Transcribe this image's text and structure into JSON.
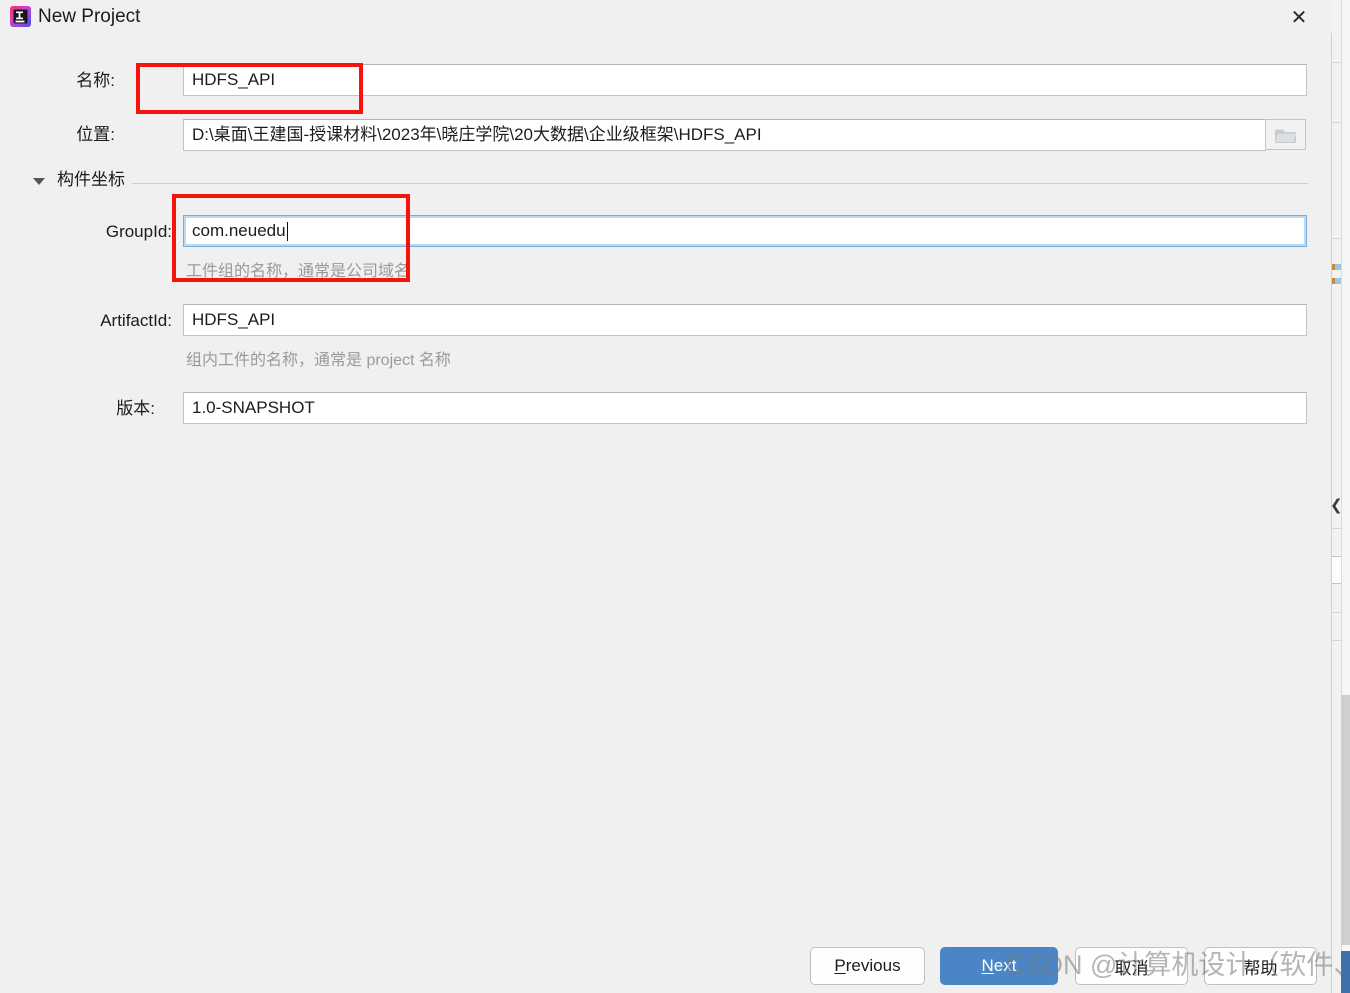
{
  "window": {
    "title": "New Project",
    "app_icon": "intellij-idea-icon",
    "close_icon": "close-icon"
  },
  "form": {
    "name": {
      "label": "名称:",
      "value": "HDFS_API"
    },
    "location": {
      "label": "位置:",
      "value": "D:\\桌面\\王建国-授课材料\\2023年\\晓庄学院\\20大数据\\企业级框架\\HDFS_API",
      "browse_icon": "folder-icon"
    },
    "section": {
      "title": "构件坐标",
      "expand_icon": "triangle-down-icon"
    },
    "group_id": {
      "label": "GroupId:",
      "value": "com.neuedu",
      "hint": "工件组的名称，通常是公司域名"
    },
    "artifact_id": {
      "label": "ArtifactId:",
      "value": "HDFS_API",
      "hint": "组内工件的名称，通常是 project 名称"
    },
    "version": {
      "label": "版本:",
      "value": "1.0-SNAPSHOT"
    }
  },
  "footer": {
    "previous": "Previous",
    "previous_mnemonic": "P",
    "previous_rest": "revious",
    "next": "Next",
    "next_mnemonic": "N",
    "next_rest": "ext",
    "cancel": "取消",
    "help": "帮助"
  },
  "watermark": {
    "text": "CSDN @计算机设计（软件、大数据）"
  },
  "colors": {
    "accent": "#4a86c5",
    "annotation": "#f5140b",
    "focus_ring": "#bcd9f2",
    "dialog_bg": "#f0f0f0",
    "hint_text": "#9a9a9a"
  }
}
